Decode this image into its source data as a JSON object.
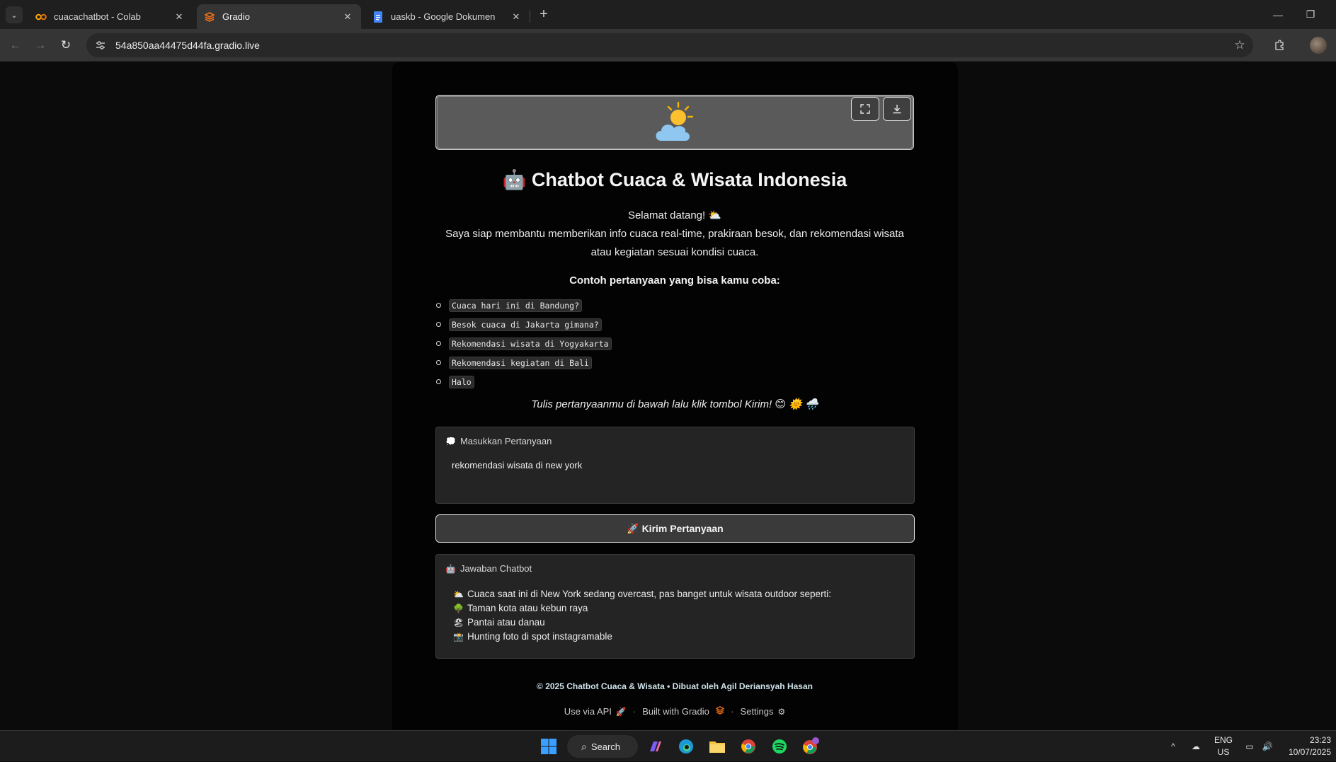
{
  "browser": {
    "tabs": [
      {
        "title": "cuacachatbot - Colab",
        "favicon": "colab-icon",
        "active": false
      },
      {
        "title": "Gradio",
        "favicon": "gradio-icon",
        "active": true
      },
      {
        "title": "uaskb - Google Dokumen",
        "favicon": "google-docs-icon",
        "active": false
      }
    ],
    "url": "54a850aa44475d44fa.gradio.live"
  },
  "app": {
    "title": "🤖 Chatbot Cuaca & Wisata Indonesia",
    "welcome_line1": "Selamat datang! ⛅",
    "welcome_line2": "Saya siap membantu memberikan info cuaca real-time, prakiraan besok, dan rekomendasi wisata atau kegiatan sesuai kondisi cuaca.",
    "examples_heading": "Contoh pertanyaan yang bisa kamu coba:",
    "examples": [
      "Cuaca hari ini di Bandung?",
      "Besok cuaca di Jakarta gimana?",
      "Rekomendasi wisata di Yogyakarta",
      "Rekomendasi kegiatan di Bali",
      "Halo"
    ],
    "hint": "Tulis pertanyaanmu di bawah lalu klik tombol Kirim! 😊 🌞 🌧️",
    "input": {
      "label": "Masukkan Pertanyaan",
      "icon": "speech-bubble-icon",
      "value": "rekomendasi wisata di new york"
    },
    "send_button": "🚀 Kirim Pertanyaan",
    "answer": {
      "label": "Jawaban Chatbot",
      "icon": "robot-icon",
      "lines": [
        {
          "emoji": "⛅",
          "text": "Cuaca saat ini di New York sedang overcast, pas banget untuk wisata outdoor seperti:"
        },
        {
          "emoji": "🌳",
          "text": "Taman kota atau kebun raya"
        },
        {
          "emoji": "🏖",
          "text": "Pantai atau danau"
        },
        {
          "emoji": "📸",
          "text": "Hunting foto di spot instagramable"
        }
      ]
    },
    "footer_note": "© 2025 Chatbot Cuaca & Wisata • Dibuat oleh Agil Deriansyah Hasan",
    "footer_links": {
      "api": "Use via API",
      "gradio": "Built with Gradio",
      "settings": "Settings"
    }
  },
  "taskbar": {
    "search_label": "Search",
    "lang_line1": "ENG",
    "lang_line2": "US",
    "time": "23:23",
    "date": "10/07/2025"
  },
  "colors": {
    "app_background": "#030303",
    "block_background": "#242424",
    "image_background": "#5a5a5a",
    "footer_accent": "#cfe3ea"
  }
}
